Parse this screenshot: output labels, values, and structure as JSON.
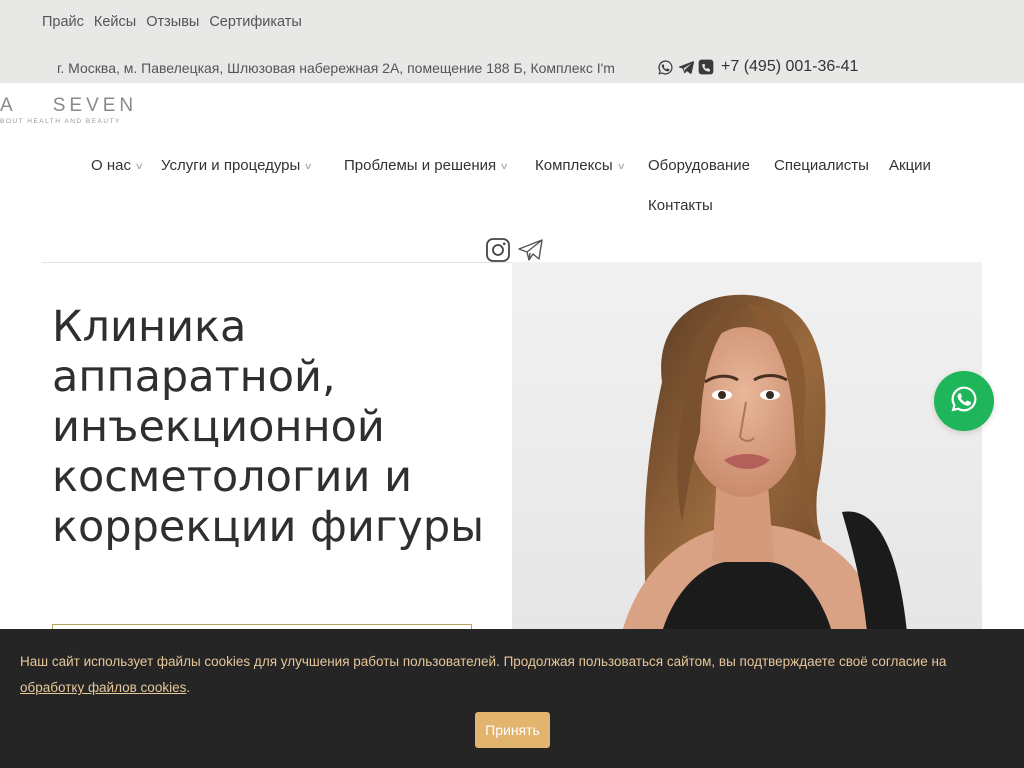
{
  "topbar": {
    "links": [
      "Прайс",
      "Кейсы",
      "Отзывы",
      "Сертификаты"
    ],
    "address": "г. Москва, м. Павелецкая, Шлюзовая набережная 2А, помещение 188 Б, Комплекс I'm",
    "phone": "+7 (495) 001-36-41"
  },
  "logo": {
    "brand": "A    SEVEN",
    "tagline": "BOUT HEALTH AND BEAUTY"
  },
  "nav": {
    "items": [
      {
        "label": "О нас"
      },
      {
        "label": "Услуги и процедуры"
      },
      {
        "label": "Проблемы и решения"
      },
      {
        "label": "Комплексы"
      },
      {
        "label": "Оборудование"
      },
      {
        "label": "Специалисты"
      },
      {
        "label": "Акции"
      },
      {
        "label": "Контакты"
      }
    ]
  },
  "social": {
    "icons": [
      "instagram-icon",
      "telegram-icon"
    ]
  },
  "hero": {
    "title": "Клиника аппаратной, инъекционной косметологии и коррекции фигуры"
  },
  "cookie": {
    "text": "Наш сайт использует файлы cookies для улучшения работы пользователей. Продолжая пользоваться сайтом, вы подтверждаете своё согласие на ",
    "link": "обработку файлов cookies",
    "suffix": ".",
    "button": "Принять"
  },
  "colors": {
    "topbar_bg": "#e8e8e6",
    "accent_gold": "#e2b46e",
    "whatsapp_green": "#1fb55a",
    "cookie_bg": "#252525",
    "cookie_text": "#e6c79a"
  }
}
